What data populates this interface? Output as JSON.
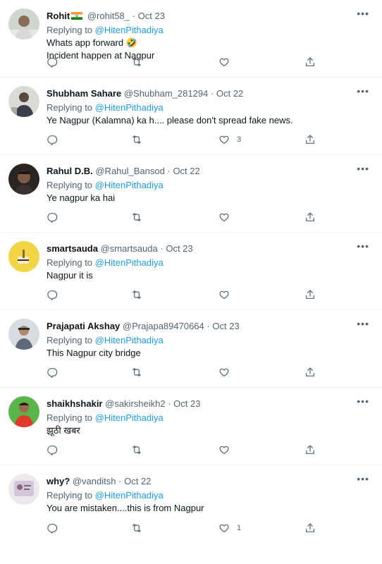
{
  "tweets": [
    {
      "name": "Rohit",
      "handle": "@rohit58_",
      "sep": "·",
      "date": "Oct 23",
      "replying_label": "Replying to",
      "replying_to": "@HitenPithadiya",
      "lines": [
        "Whats app forward 🤣",
        "Incident happen at Nagpur"
      ],
      "likes": "",
      "has_flag": true
    },
    {
      "name": "Shubham Sahare",
      "handle": "@Shubham_281294",
      "sep": "·",
      "date": "Oct 22",
      "replying_label": "Replying to",
      "replying_to": "@HitenPithadiya",
      "lines": [
        "Ye Nagpur (Kalamna) ka h.... please don't spread fake news."
      ],
      "likes": "3"
    },
    {
      "name": "Rahul D.B.",
      "handle": "@Rahul_Bansod",
      "sep": "·",
      "date": "Oct 22",
      "replying_label": "Replying to",
      "replying_to": "@HitenPithadiya",
      "lines": [
        "Ye nagpur ka hai"
      ],
      "likes": ""
    },
    {
      "name": "smartsauda",
      "handle": "@smartsauda",
      "sep": "·",
      "date": "Oct 23",
      "replying_label": "Replying to",
      "replying_to": "@HitenPithadiya",
      "lines": [
        "Nagpur it is"
      ],
      "likes": ""
    },
    {
      "name": "Prajapati Akshay",
      "handle": "@Prajapa89470664",
      "sep": "·",
      "date": "Oct 23",
      "replying_label": "Replying to",
      "replying_to": "@HitenPithadiya",
      "lines": [
        "This Nagpur city bridge"
      ],
      "likes": ""
    },
    {
      "name": "shaikhshakir",
      "handle": "@sakirsheikh2",
      "sep": "·",
      "date": "Oct 23",
      "replying_label": "Replying to",
      "replying_to": "@HitenPithadiya",
      "lines": [
        "झूठी खबर"
      ],
      "likes": ""
    },
    {
      "name": "why?",
      "handle": "@vanditsh",
      "sep": "·",
      "date": "Oct 22",
      "replying_label": "Replying to",
      "replying_to": "@HitenPithadiya",
      "lines": [
        "You are mistaken....this is from Nagpur"
      ],
      "likes": "1"
    }
  ],
  "more_label": "•••",
  "colors": {
    "link": "#1d9bf0",
    "muted": "#536471",
    "text": "#0f1419",
    "divider": "#eff3f4"
  },
  "icons": {
    "reply": "reply-icon",
    "retweet": "retweet-icon",
    "like": "heart-icon",
    "share": "share-icon",
    "more": "more-icon"
  }
}
